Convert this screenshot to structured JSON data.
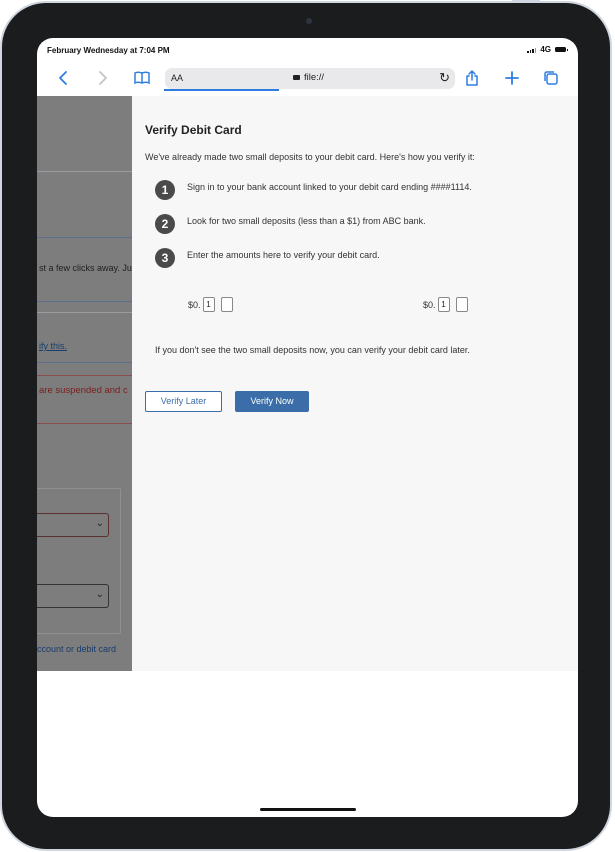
{
  "status_bar": {
    "time": "February Wednesday at 7:04 PM",
    "network": "4G"
  },
  "browser": {
    "text_size_label": "AA",
    "url": "file://",
    "icons": [
      "back-icon",
      "forward-icon",
      "bookmarks-icon",
      "lock-icon",
      "reload-icon",
      "share-icon",
      "new-tab-icon",
      "tabs-icon"
    ]
  },
  "background_page": {
    "snippet_1": "st a few clicks away. Ju",
    "link": "ify this.",
    "warning": "are suspended and c",
    "bottom_link": "ccount or debit card"
  },
  "modal": {
    "title": "Verify Debit Card",
    "intro": "We've already made two small deposits to your debit card. Here's how you verify it:",
    "steps": [
      {
        "number": "1",
        "text": "Sign in to your bank account linked to your debit card ending ####1114."
      },
      {
        "number": "2",
        "text": "Look for two small deposits (less than a $1) from ABC bank."
      },
      {
        "number": "3",
        "text": "Enter the amounts here to verify your debit card."
      }
    ],
    "amount_1": {
      "prefix": "$0.",
      "digit_1": "1",
      "digit_2": ""
    },
    "amount_2": {
      "prefix": "$0.",
      "digit_1": "1",
      "digit_2": ""
    },
    "note": "If you don't see the two small deposits now, you can verify your debit card later.",
    "verify_later_label": "Verify Later",
    "verify_now_label": "Verify Now"
  },
  "colors": {
    "accent": "#3b6ea8",
    "browser_blue": "#2f7de1",
    "overlay": "#7d7d7d"
  }
}
